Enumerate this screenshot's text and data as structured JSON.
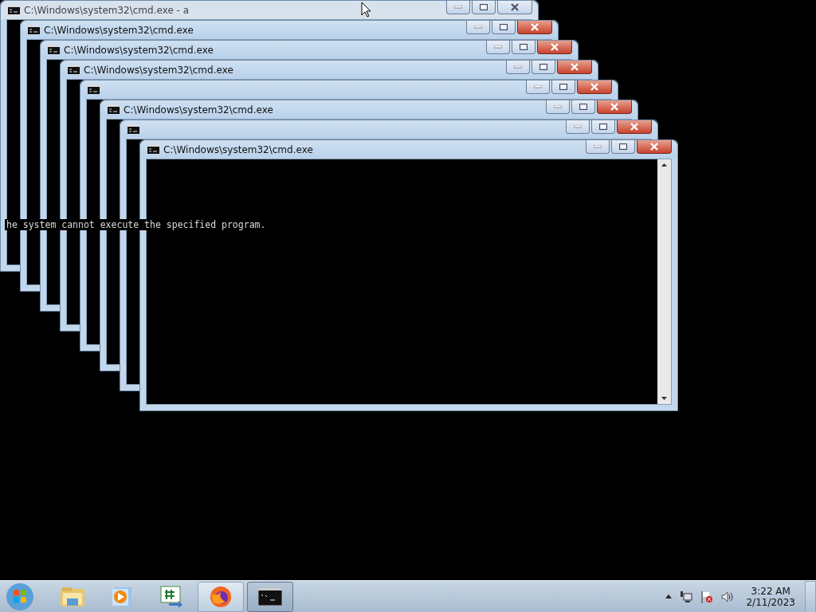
{
  "windows": [
    {
      "title": "C:\\Windows\\system32\\cmd.exe - a",
      "focused": false
    },
    {
      "title": "C:\\Windows\\system32\\cmd.exe",
      "focused": true
    },
    {
      "title": "C:\\Windows\\system32\\cmd.exe",
      "focused": true
    },
    {
      "title": "C:\\Windows\\system32\\cmd.exe",
      "focused": true
    },
    {
      "focused": true
    },
    {
      "title": "C:\\Windows\\system32\\cmd.exe",
      "focused": true
    },
    {
      "focused": true
    },
    {
      "title": "C:\\Windows\\system32\\cmd.exe",
      "focused": true
    }
  ],
  "console_text": "he system cannot execute the specified program.",
  "taskbar": {
    "items": [
      {
        "kind": "folder",
        "running": false,
        "selected": false
      },
      {
        "kind": "media",
        "running": false,
        "selected": false
      },
      {
        "kind": "csharp",
        "running": false,
        "selected": false
      },
      {
        "kind": "firefox",
        "running": true,
        "selected": false
      },
      {
        "kind": "console",
        "running": true,
        "selected": true
      }
    ],
    "clock": {
      "time": "3:22 AM",
      "date": "2/11/2023"
    }
  }
}
